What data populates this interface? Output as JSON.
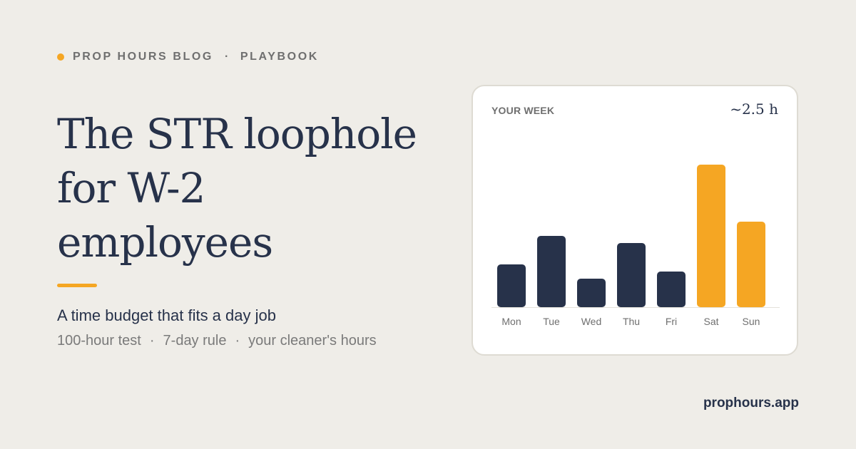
{
  "eyebrow": {
    "brand": "PROP HOURS BLOG",
    "separator": "·",
    "section": "PLAYBOOK"
  },
  "headline": {
    "line1": "The STR loophole",
    "line2": "for W-2",
    "line3": "employees"
  },
  "subtitle": "A time budget that fits a day job",
  "tags": {
    "items": [
      "100-hour test",
      "7-day rule",
      "your cleaner's hours"
    ],
    "separator": "·"
  },
  "card": {
    "label": "YOUR WEEK",
    "total": "~2.5 h"
  },
  "chart_data": {
    "type": "bar",
    "categories": [
      "Mon",
      "Tue",
      "Wed",
      "Thu",
      "Fri",
      "Sat",
      "Sun"
    ],
    "values": [
      0.3,
      0.5,
      0.2,
      0.45,
      0.25,
      1.0,
      0.6
    ],
    "units": "h",
    "ylim": [
      0,
      1.1
    ],
    "grid": false,
    "legend": "none",
    "colors": {
      "weekday": "#27324a",
      "weekend": "#f5a623"
    },
    "highlight_categories": [
      "Sat",
      "Sun"
    ]
  },
  "footer": {
    "url": "prophours.app"
  },
  "colors": {
    "background": "#efede8",
    "accent": "#f5a623",
    "navy": "#27324a",
    "muted": "#7a7a7a"
  }
}
